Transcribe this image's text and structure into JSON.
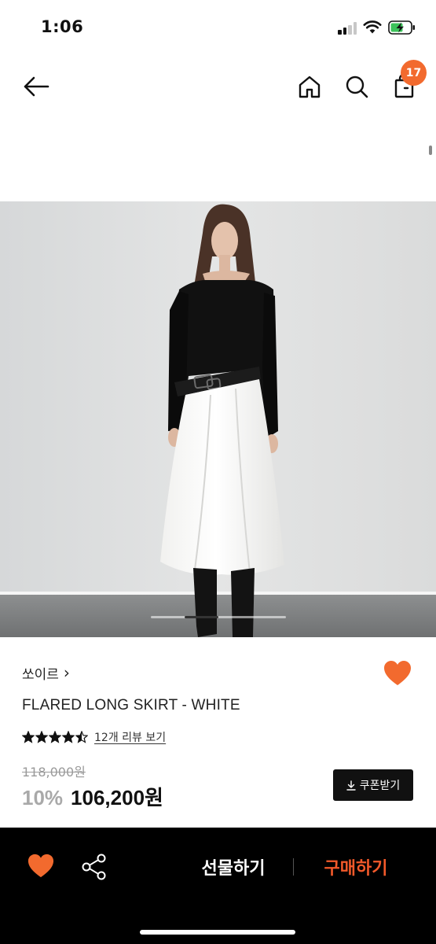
{
  "status_bar": {
    "time": "1:06",
    "signal_icon": "cellular-signal-icon",
    "wifi_icon": "wifi-icon",
    "battery_icon": "battery-charging-icon"
  },
  "nav": {
    "back_icon": "arrow-left-icon",
    "home_icon": "home-icon",
    "search_icon": "search-icon",
    "cart_icon": "shopping-bag-icon",
    "cart_badge": "17"
  },
  "carousel": {
    "current_slide_fraction": 0.25
  },
  "product": {
    "brand": "쏘이르",
    "brand_chevron": "›",
    "name": "FLARED LONG SKIRT - WHITE",
    "rating": 4.5,
    "review_link": "12개 리뷰 보기",
    "original_price": "118,000원",
    "discount": "10%",
    "sale_price": "106,200원",
    "coupon_label": "쿠폰받기",
    "coupon_icon": "download-icon",
    "wish_icon": "heart-icon"
  },
  "bottom_bar": {
    "heart_icon": "heart-icon",
    "share_icon": "share-icon",
    "gift_label": "선물하기",
    "buy_label": "구매하기"
  },
  "colors": {
    "accent": "#f26a2e",
    "buy": "#f2592a",
    "bar": "#000000"
  }
}
